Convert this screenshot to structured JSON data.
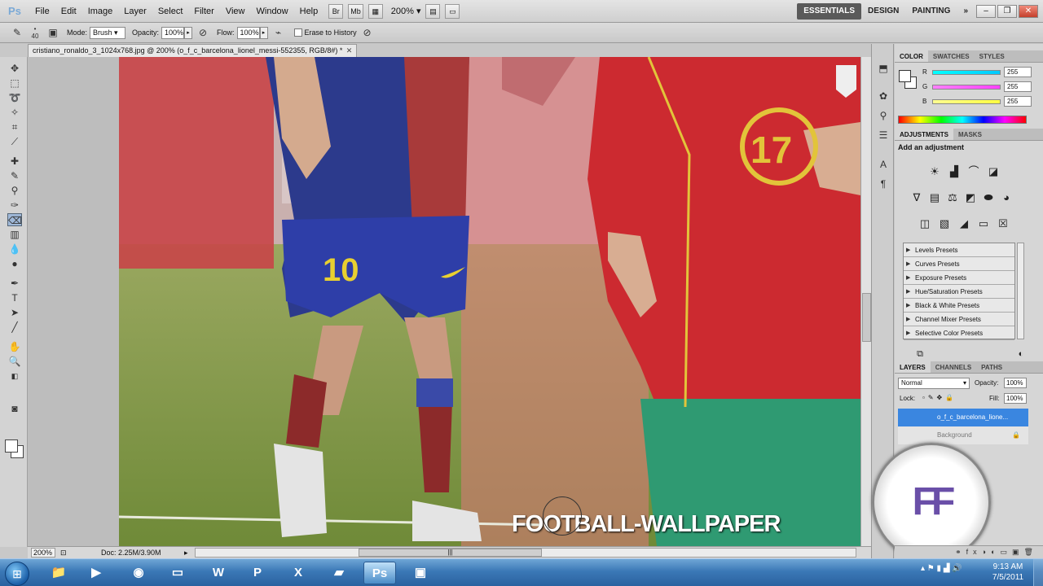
{
  "app": {
    "logo": "Ps"
  },
  "menu": [
    "File",
    "Edit",
    "Image",
    "Layer",
    "Select",
    "Filter",
    "View",
    "Window",
    "Help"
  ],
  "menubar_extra": {
    "zoom": "200%",
    "bridge": "Br",
    "minibridge": "Mb"
  },
  "workspaces": [
    "ESSENTIALS",
    "DESIGN",
    "PAINTING"
  ],
  "options": {
    "brush_size": "40",
    "mode_label": "Mode:",
    "mode_value": "Brush",
    "opacity_label": "Opacity:",
    "opacity_value": "100%",
    "flow_label": "Flow:",
    "flow_value": "100%",
    "erase_history": "Erase to History"
  },
  "document": {
    "tab_title": "cristiano_ronaldo_3_1024x768.jpg @ 200% (o_f_c_barcelona_lionel_messi-552355, RGB/8#) *",
    "watermark": "FOOTBALL-WALLPAPER",
    "jersey_left": "10",
    "jersey_right": "17"
  },
  "status": {
    "zoom": "200%",
    "doc_info": "Doc: 2.25M/3.90M"
  },
  "color_panel": {
    "tabs": [
      "COLOR",
      "SWATCHES",
      "STYLES"
    ],
    "channels": [
      {
        "label": "R",
        "value": "255",
        "color": "#00c8ff"
      },
      {
        "label": "G",
        "value": "255",
        "color": "#ff40ff"
      },
      {
        "label": "B",
        "value": "255",
        "color": "#ffff40"
      }
    ]
  },
  "adjustments": {
    "tabs": [
      "ADJUSTMENTS",
      "MASKS"
    ],
    "title": "Add an adjustment",
    "presets": [
      "Levels Presets",
      "Curves Presets",
      "Exposure Presets",
      "Hue/Saturation Presets",
      "Black & White Presets",
      "Channel Mixer Presets",
      "Selective Color Presets"
    ]
  },
  "layers": {
    "tabs": [
      "LAYERS",
      "CHANNELS",
      "PATHS"
    ],
    "blend_mode": "Normal",
    "opacity_label": "Opacity:",
    "opacity_value": "100%",
    "lock_label": "Lock:",
    "fill_label": "Fill:",
    "fill_value": "100%",
    "items": [
      "o_f_c_barcelona_lione...",
      "Background"
    ]
  },
  "taskbar": {
    "time": "9:13 AM",
    "date": "7/5/2011"
  }
}
